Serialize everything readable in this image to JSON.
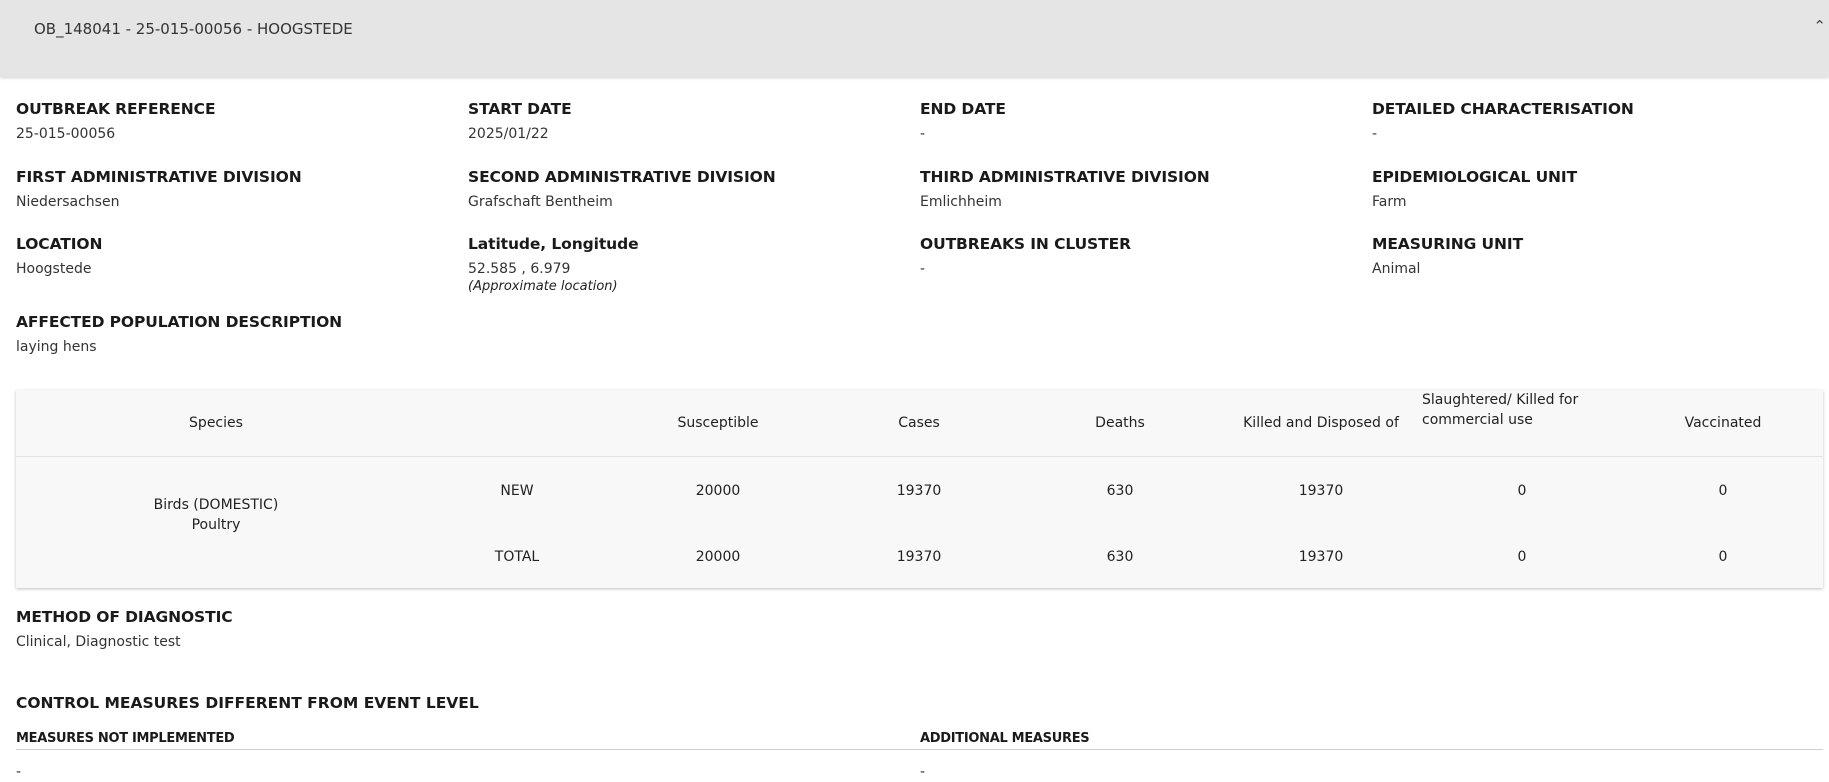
{
  "header": {
    "title": "OB_148041 - 25-015-00056 - HOOGSTEDE"
  },
  "fields": {
    "outbreak_reference": {
      "label": "OUTBREAK REFERENCE",
      "value": "25-015-00056"
    },
    "start_date": {
      "label": "START DATE",
      "value": "2025/01/22"
    },
    "end_date": {
      "label": "END DATE",
      "value": "-"
    },
    "detailed_characterisation": {
      "label": "DETAILED CHARACTERISATION",
      "value": "-"
    },
    "first_admin_division": {
      "label": "FIRST ADMINISTRATIVE DIVISION",
      "value": "Niedersachsen"
    },
    "second_admin_division": {
      "label": "SECOND ADMINISTRATIVE DIVISION",
      "value": "Grafschaft Bentheim"
    },
    "third_admin_division": {
      "label": "THIRD ADMINISTRATIVE DIVISION",
      "value": "Emlichheim"
    },
    "epidemiological_unit": {
      "label": "EPIDEMIOLOGICAL UNIT",
      "value": "Farm"
    },
    "location": {
      "label": "LOCATION",
      "value": "Hoogstede"
    },
    "lat_long": {
      "label": "Latitude, Longitude",
      "value": "52.585 , 6.979",
      "note": "(Approximate location)"
    },
    "outbreaks_in_cluster": {
      "label": "OUTBREAKS IN CLUSTER",
      "value": "-"
    },
    "measuring_unit": {
      "label": "MEASURING UNIT",
      "value": "Animal"
    },
    "affected_population": {
      "label": "AFFECTED POPULATION DESCRIPTION",
      "value": "laying hens"
    }
  },
  "table": {
    "headers": {
      "species": "Species",
      "susceptible": "Susceptible",
      "cases": "Cases",
      "deaths": "Deaths",
      "killed": "Killed and Disposed of",
      "slaughtered_line1": "Slaughtered/ Killed for",
      "slaughtered_line2": "commercial use",
      "vaccinated": "Vaccinated"
    },
    "species_line1": "Birds (DOMESTIC)",
    "species_line2": "Poultry",
    "rows": [
      {
        "type": "NEW",
        "susceptible": "20000",
        "cases": "19370",
        "deaths": "630",
        "killed": "19370",
        "slaughtered": "0",
        "vaccinated": "0"
      },
      {
        "type": "TOTAL",
        "susceptible": "20000",
        "cases": "19370",
        "deaths": "630",
        "killed": "19370",
        "slaughtered": "0",
        "vaccinated": "0"
      }
    ]
  },
  "diagnostic": {
    "label": "METHOD OF DIAGNOSTIC",
    "value": "Clinical, Diagnostic test"
  },
  "control_measures": {
    "title": "CONTROL MEASURES DIFFERENT FROM EVENT LEVEL",
    "not_implemented_label": "MEASURES NOT IMPLEMENTED",
    "not_implemented_value": "-",
    "additional_label": "ADDITIONAL MEASURES",
    "additional_value": "-"
  }
}
